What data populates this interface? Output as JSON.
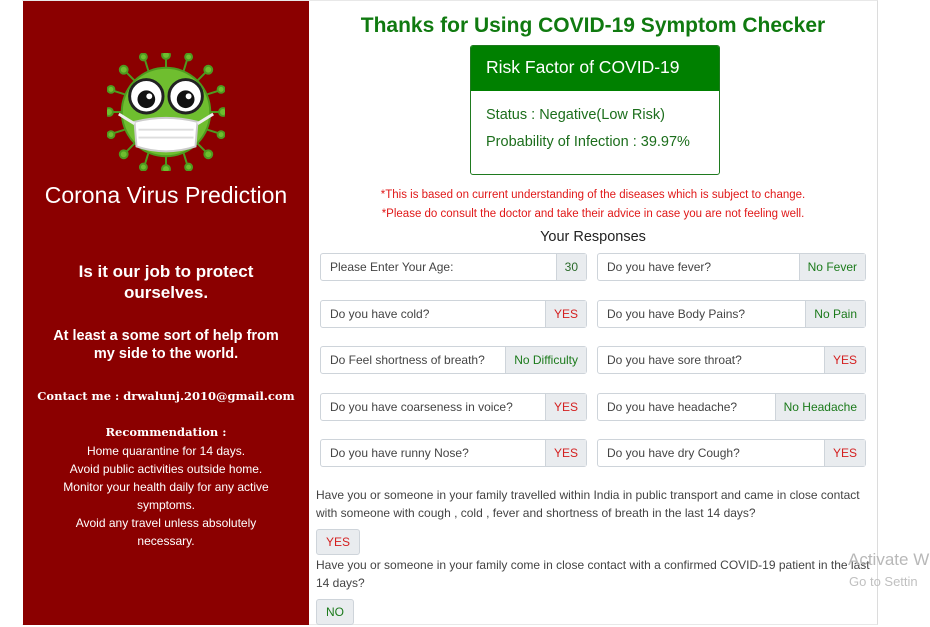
{
  "sidebar": {
    "brand": "Corona Virus Prediction",
    "tagline": "Is it our job to protect ourselves.",
    "blurb": "At least a some sort of help from my side to the world.",
    "contact": "Contact me : drwalunj.2010@gmail.com",
    "recommendation_title": "Recommendation :",
    "recommendations": [
      "Home quarantine for 14 days.",
      "Avoid public activities outside home.",
      "Monitor your health daily for any active symptoms.",
      "Avoid any travel unless absolutely necessary."
    ],
    "logo_icon": "virus-mask-mascot-icon",
    "bg_color": "#8b0000"
  },
  "main": {
    "title": "Thanks for Using COVID-19 Symptom Checker",
    "risk_card": {
      "header": "Risk Factor of COVID-19",
      "status": "Status : Negative(Low Risk)",
      "probability": "Probability of Infection : 39.97%"
    },
    "notes": [
      "*This is based on current understanding of the diseases which is subject to change.",
      "*Please do consult the doctor and take their advice in case you are not feeling well."
    ],
    "responses_title": "Your Responses",
    "responses": [
      {
        "q": "Please Enter Your Age:",
        "a": "30"
      },
      {
        "q": "Do you have fever?",
        "a": "No Fever"
      },
      {
        "q": "Do you have cold?",
        "a": "YES"
      },
      {
        "q": "Do you have Body Pains?",
        "a": "No Pain"
      },
      {
        "q": "Do Feel shortness of breath?",
        "a": "No Difficulty"
      },
      {
        "q": "Do you have sore throat?",
        "a": "YES"
      },
      {
        "q": "Do you have coarseness in voice?",
        "a": "YES"
      },
      {
        "q": "Do you have headache?",
        "a": "No Headache"
      },
      {
        "q": "Do you have runny Nose?",
        "a": "YES"
      },
      {
        "q": "Do you have dry Cough?",
        "a": "YES"
      }
    ],
    "travel_question": "Have you or someone in your family travelled within India in public transport and came in close contact with someone with cough , cold , fever and shortness of breath in the last 14 days?",
    "travel_answer": "YES",
    "contact_question": "Have you or someone in your family come in close contact with a confirmed COVID-19 patient in the last 14 days?",
    "contact_answer": "NO"
  },
  "watermark": {
    "line1": "Activate W",
    "line2": "Go to Settin"
  },
  "colors": {
    "title_green": "#107a10",
    "card_green": "#008000",
    "warning_red": "#e01818",
    "yes_red": "#d42020",
    "no_green": "#1b7a1b"
  }
}
